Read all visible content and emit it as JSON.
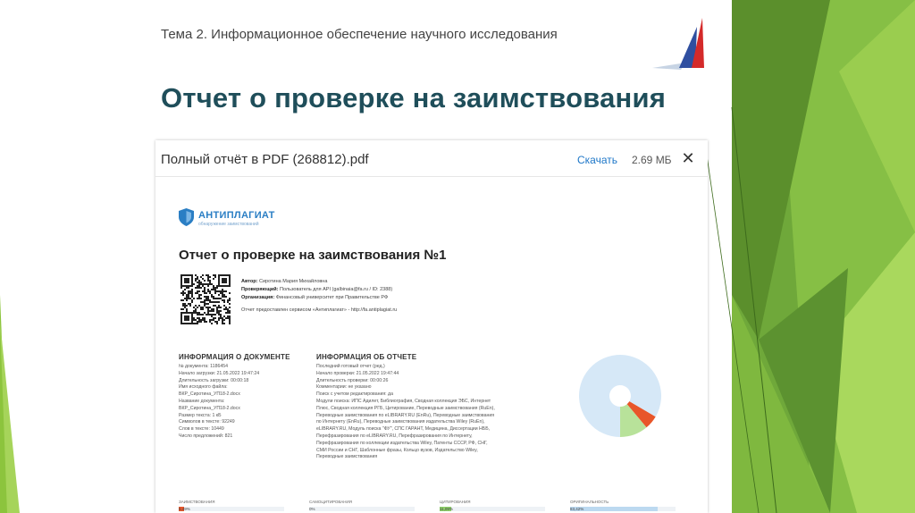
{
  "slide": {
    "header": "Тема 2. Информационное обеспечение научного исследования",
    "title": "Отчет о проверке на заимствования"
  },
  "viewer": {
    "filename": "Полный отчёт в PDF (268812).pdf",
    "download_label": "Скачать",
    "file_size": "2.69 МБ",
    "close_label": "✕"
  },
  "report": {
    "brand_name": "АНТИПЛАГИАТ",
    "brand_sub": "обнаружение заимствований",
    "title": "Отчет о проверке на заимствования №1",
    "meta": [
      {
        "label": "Автор:",
        "value": "Сиротина Мария Михайловна"
      },
      {
        "label": "Проверяющий:",
        "value": "Пользователь для API (galbinaia@fa.ru / ID: 2388)"
      },
      {
        "label": "Организация:",
        "value": "Финансовый университет при Правительстве РФ"
      }
    ],
    "service_note": "Отчет предоставлен сервисом «Антиплагиат» - http://fa.antiplagiat.ru",
    "doc_info_title": "ИНФОРМАЦИЯ О ДОКУМЕНТЕ",
    "doc_info": [
      "№ документа: 1186454",
      "Начало загрузки: 21.05.2022 19:47:24",
      "Длительность загрузки: 00:00:18",
      "Имя исходного файла:",
      "ВКР_Сиротина_УП18-2.docx",
      "Название документа:",
      "ВКР_Сиротина_УП18-2.docx",
      "Размер текста: 1 кБ",
      "Символов в тексте: 92249",
      "Слов в тексте: 10449",
      "Число предложений: 821"
    ],
    "report_info_title": "ИНФОРМАЦИЯ ОБ ОТЧЕТЕ",
    "report_info": [
      "Последний готовый отчет (ред.)",
      "Начало проверки: 21.05.2022 19:47:44",
      "Длительность проверки: 00:00:26",
      "Комментарии: не указано",
      "Поиск с учетом редактирования: да",
      "Модули поиска: ИПС Адилет, Библиография, Сводная коллекция ЭБС, Интернет",
      "Плюс, Сводная коллекция РГБ, Цитирование, Переводные заимствования (RuEn),",
      "Переводные заимствования по eLIBRARY.RU (EnRu), Переводные заимствования",
      "по Интернету (EnRu), Переводные заимствования издательства Wiley (RuEn),",
      "eLIBRARY.RU, Модуль поиска \"ФУ\", СПС ГАРАНТ, Медицина, Диссертации НББ,",
      "Перефразирования по eLIBRARY.RU, Перефразирования по Интернету,",
      "Перефразирования по коллекции издательства Wiley, Патенты СССР, РФ, СНГ,",
      "СМИ России и СНГ, Шаблонные фразы, Кольцо вузов, Издательство Wiley,",
      "Переводные заимствования"
    ],
    "metrics": [
      {
        "label": "ЗАИМСТВОВАНИЯ",
        "value": "5,49%",
        "fraction": 0.055,
        "color": "#e8562a"
      },
      {
        "label": "САМОЦИТИРОВАНИЯ",
        "value": "0%",
        "fraction": 0.0,
        "color": "#f2b544"
      },
      {
        "label": "ЦИТИРОВАНИЯ",
        "value": "11,09%",
        "fraction": 0.111,
        "color": "#8fd16a"
      },
      {
        "label": "ОРИГИНАЛЬНОСТЬ",
        "value": "83,42%",
        "fraction": 0.834,
        "color": "#bcd9f0"
      }
    ],
    "pie": [
      {
        "name": "Заимствования",
        "fraction": 0.055,
        "color": "#e8562a"
      },
      {
        "name": "Цитирования",
        "fraction": 0.111,
        "color": "#b8e29a"
      },
      {
        "name": "Оригинальность",
        "fraction": 0.834,
        "color": "#d6e8f7"
      }
    ]
  },
  "colors": {
    "title": "#1f4e5a",
    "link": "#1e77c8",
    "green_dark": "#4d8a2a",
    "green_light": "#8cc43d"
  }
}
